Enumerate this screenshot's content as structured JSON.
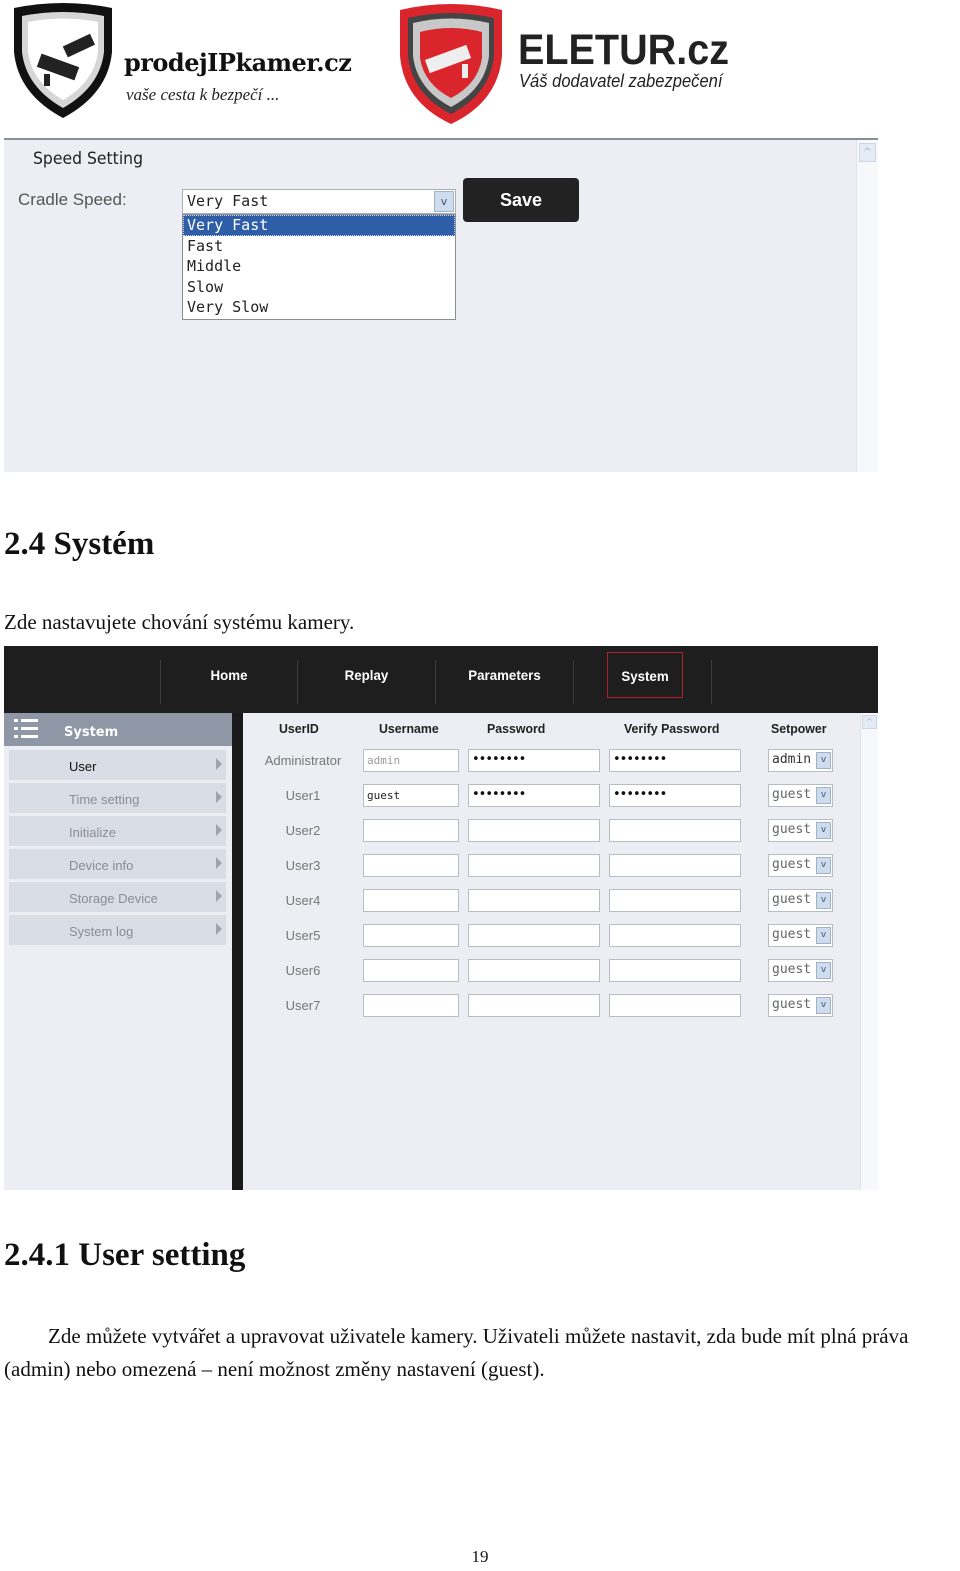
{
  "logos": {
    "left": {
      "name": "prodejIPkamer.cz",
      "tagline": "vaše cesta k bezpečí ...",
      "icon": "shield-camera-icon-black"
    },
    "right": {
      "name": "ELETUR.cz",
      "tagline": "Váš dodavatel zabezpečení",
      "icon": "shield-camera-icon-red"
    }
  },
  "speed_setting": {
    "title": "Speed Setting",
    "field_label": "Cradle Speed:",
    "selected_value": "Very Fast",
    "options": [
      "Very Fast",
      "Fast",
      "Middle",
      "Slow",
      "Very Slow"
    ],
    "highlighted_option": "Very Fast",
    "save_label": "Save",
    "scroll_up_glyph": "^"
  },
  "section_system": {
    "heading": "2.4 Systém",
    "intro": "Zde nastavujete chování systému kamery."
  },
  "system_ui": {
    "nav": [
      {
        "label": "Home",
        "active": false
      },
      {
        "label": "Replay",
        "active": false
      },
      {
        "label": "Parameters",
        "active": false
      },
      {
        "label": "System",
        "active": true
      }
    ],
    "sidebar": {
      "title": "System",
      "items": [
        {
          "label": "User",
          "active": true
        },
        {
          "label": "Time setting",
          "active": false
        },
        {
          "label": "Initialize",
          "active": false
        },
        {
          "label": "Device info",
          "active": false
        },
        {
          "label": "Storage Device",
          "active": false
        },
        {
          "label": "System log",
          "active": false
        }
      ]
    },
    "table": {
      "headers": {
        "userid": "UserID",
        "username": "Username",
        "password": "Password",
        "verify": "Verify Password",
        "setpower": "Setpower"
      },
      "rows": [
        {
          "userid": "Administrator",
          "username": "admin",
          "password": "••••••••",
          "verify": "••••••••",
          "setpower": "admin",
          "username_disabled": true
        },
        {
          "userid": "User1",
          "username": "guest",
          "password": "••••••••",
          "verify": "••••••••",
          "setpower": "guest",
          "username_disabled": false
        },
        {
          "userid": "User2",
          "username": "",
          "password": "",
          "verify": "",
          "setpower": "guest",
          "username_disabled": false
        },
        {
          "userid": "User3",
          "username": "",
          "password": "",
          "verify": "",
          "setpower": "guest",
          "username_disabled": false
        },
        {
          "userid": "User4",
          "username": "",
          "password": "",
          "verify": "",
          "setpower": "guest",
          "username_disabled": false
        },
        {
          "userid": "User5",
          "username": "",
          "password": "",
          "verify": "",
          "setpower": "guest",
          "username_disabled": false
        },
        {
          "userid": "User6",
          "username": "",
          "password": "",
          "verify": "",
          "setpower": "guest",
          "username_disabled": false
        },
        {
          "userid": "User7",
          "username": "",
          "password": "",
          "verify": "",
          "setpower": "guest",
          "username_disabled": false
        }
      ]
    },
    "dropdown_glyph": "v",
    "scroll_up_glyph": "^"
  },
  "section_user": {
    "heading": "2.4.1 User setting",
    "line1": "Zde můžete vytvářet a upravovat uživatele kamery. Uživateli můžete nastavit, zda bude mít plná práva",
    "line2": "(admin) nebo omezená – není možnost změny nastavení (guest)."
  },
  "page_number": "19",
  "colors": {
    "nav_bg": "#1e1e1e",
    "nav_active_border": "#b3222a",
    "panel_bg": "#eceef3",
    "sidebar_header": "#8f96a6",
    "selected_option": "#2f5ea8",
    "save_button": "#222222",
    "logo_red": "#d9252b"
  }
}
